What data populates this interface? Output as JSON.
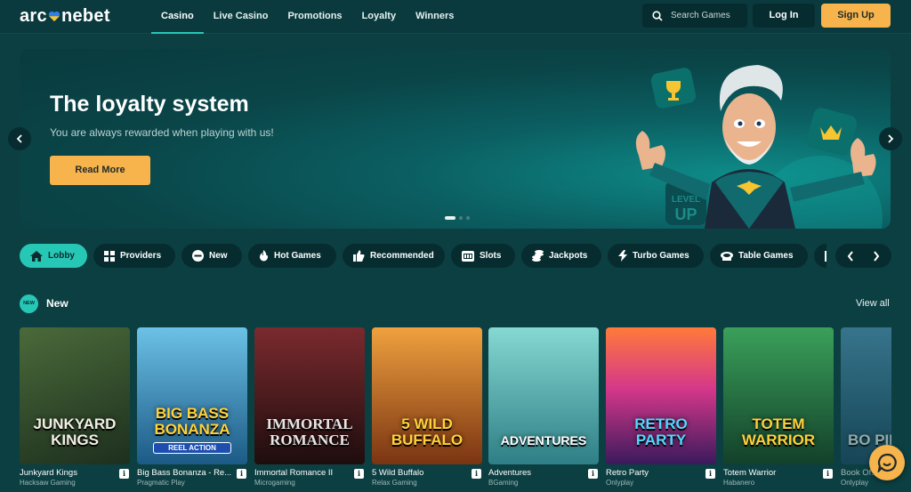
{
  "header": {
    "logo_parts": [
      "arc",
      "nebet"
    ],
    "nav": [
      {
        "label": "Casino",
        "active": true
      },
      {
        "label": "Live Casino",
        "active": false
      },
      {
        "label": "Promotions",
        "active": false
      },
      {
        "label": "Loyalty",
        "active": false
      },
      {
        "label": "Winners",
        "active": false
      }
    ],
    "search_placeholder": "Search Games",
    "login_label": "Log In",
    "signup_label": "Sign Up"
  },
  "hero": {
    "title": "The loyalty system",
    "subtitle": "You are always rewarded when playing with us!",
    "button_label": "Read More",
    "art_badge_text": [
      "LEVEL",
      "UP"
    ],
    "slide_count": 3,
    "active_slide": 1
  },
  "categories": [
    {
      "label": "Lobby",
      "icon": "home-icon",
      "active": true
    },
    {
      "label": "Providers",
      "icon": "grid-icon",
      "active": false
    },
    {
      "label": "New",
      "icon": "new-badge-icon",
      "active": false
    },
    {
      "label": "Hot Games",
      "icon": "flame-icon",
      "active": false
    },
    {
      "label": "Recommended",
      "icon": "thumbs-up-icon",
      "active": false
    },
    {
      "label": "Slots",
      "icon": "slot-machine-icon",
      "active": false
    },
    {
      "label": "Jackpots",
      "icon": "coins-icon",
      "active": false
    },
    {
      "label": "Turbo Games",
      "icon": "lightning-icon",
      "active": false
    },
    {
      "label": "Table Games",
      "icon": "table-chip-icon",
      "active": false
    }
  ],
  "section": {
    "badge": "NEW",
    "title": "New",
    "view_all": "View all"
  },
  "games": [
    {
      "name": "Junkyard Kings",
      "provider": "Hacksaw Gaming",
      "art_title": "JUNKYARD KINGS",
      "colors": [
        "#2f4a2a",
        "#1d2f1e"
      ]
    },
    {
      "name": "Big Bass Bonanza - Re...",
      "provider": "Pragmatic Play",
      "art_title": "BIG BASS BONANZA",
      "art_sub": "REEL ACTION",
      "colors": [
        "#4aa6d6",
        "#1c5a86"
      ]
    },
    {
      "name": "Immortal Romance II",
      "provider": "Microgaming",
      "art_title": "IMMORTAL ROMANCE",
      "colors": [
        "#5a1f22",
        "#1e0d0e"
      ]
    },
    {
      "name": "5 Wild Buffalo",
      "provider": "Relax Gaming",
      "art_title": "5 WILD BUFFALO",
      "colors": [
        "#e08a2e",
        "#7a3412"
      ]
    },
    {
      "name": "Adventures",
      "provider": "BGaming",
      "art_title": "ADVENTURES",
      "colors": [
        "#6ec9c4",
        "#2e7f86"
      ]
    },
    {
      "name": "Retro Party",
      "provider": "Onlyplay",
      "art_title": "RETRO PARTY",
      "colors": [
        "#d4378a",
        "#3a1a5c"
      ]
    },
    {
      "name": "Totem Warrior",
      "provider": "Habanero",
      "art_title": "TOTEM WARRIOR",
      "colors": [
        "#2f8a4a",
        "#13402a"
      ]
    },
    {
      "name": "Book Of...",
      "provider": "Onlyplay",
      "art_title": "BO PIN",
      "colors": [
        "#3a7fa8",
        "#1e4a66"
      ]
    }
  ],
  "colors": {
    "background": "#0c3f42",
    "accent_teal": "#27c7b6",
    "accent_orange": "#f7b34c",
    "dark_pill": "#072c2f"
  }
}
